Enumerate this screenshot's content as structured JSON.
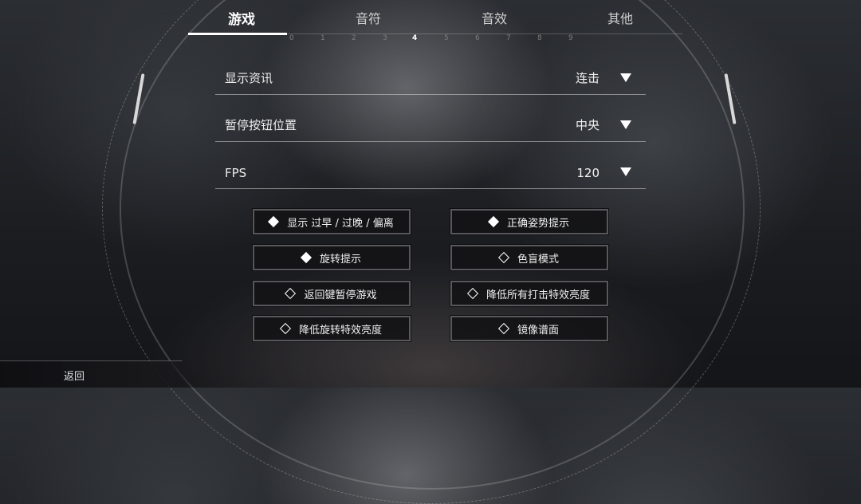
{
  "tabs": [
    {
      "label": "游戏",
      "active": true
    },
    {
      "label": "音符",
      "active": false
    },
    {
      "label": "音效",
      "active": false
    },
    {
      "label": "其他",
      "active": false
    }
  ],
  "pager": {
    "ticks": [
      "0",
      "1",
      "2",
      "3",
      "4",
      "5",
      "6",
      "7",
      "8",
      "9"
    ],
    "active_index": 4
  },
  "settings": [
    {
      "label": "显示资讯",
      "value": "连击"
    },
    {
      "label": "暂停按钮位置",
      "value": "中央"
    },
    {
      "label": "FPS",
      "value": "120"
    }
  ],
  "options": [
    {
      "label": "显示 过早 / 过晚 / 偏离",
      "checked": true
    },
    {
      "label": "正确姿势提示",
      "checked": true
    },
    {
      "label": "旋转提示",
      "checked": true
    },
    {
      "label": "色盲模式",
      "checked": false
    },
    {
      "label": "返回键暂停游戏",
      "checked": false
    },
    {
      "label": "降低所有打击特效亮度",
      "checked": false
    },
    {
      "label": "降低旋转特效亮度",
      "checked": false
    },
    {
      "label": "镜像谱面",
      "checked": false
    }
  ],
  "footer": {
    "back_label": "返回"
  },
  "colors": {
    "accent": "#ffffff",
    "button_bg": "#141416",
    "button_border": "#5f5f64"
  },
  "icons": {
    "dropdown": "triangle-down-icon",
    "checked": "filled-diamond-icon",
    "unchecked": "outline-diamond-icon"
  }
}
